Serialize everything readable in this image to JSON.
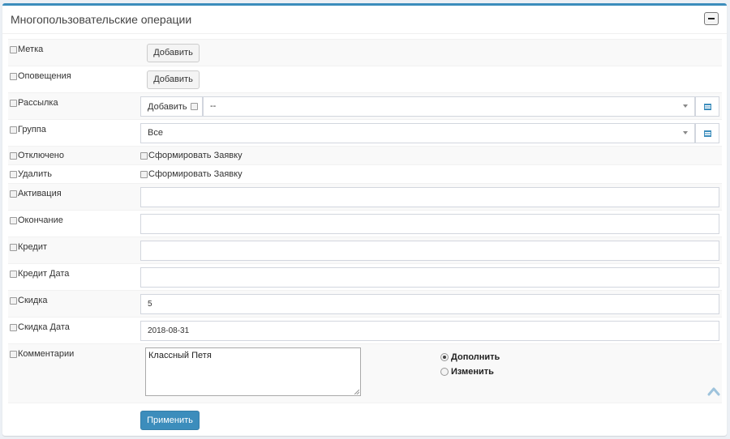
{
  "panel": {
    "title": "Многопользовательские операции",
    "collapse_icon": "minus-icon"
  },
  "rows": {
    "label": {
      "name": "Метка",
      "button": "Добавить"
    },
    "notifications": {
      "name": "Оповещения",
      "button": "Добавить"
    },
    "mailing": {
      "name": "Рассылка",
      "addon": "Добавить",
      "select_value": "--"
    },
    "group": {
      "name": "Группа",
      "select_value": "Все"
    },
    "disabled": {
      "name": "Отключено",
      "option": "Сформировать Заявку"
    },
    "delete": {
      "name": "Удалить",
      "option": "Сформировать Заявку"
    },
    "activation": {
      "name": "Активация",
      "value": ""
    },
    "ending": {
      "name": "Окончание",
      "value": ""
    },
    "credit": {
      "name": "Кредит",
      "value": ""
    },
    "credit_date": {
      "name": "Кредит Дата",
      "value": ""
    },
    "discount": {
      "name": "Скидка",
      "value": "5"
    },
    "discount_date": {
      "name": "Скидка Дата",
      "value": "2018-08-31"
    },
    "comments": {
      "name": "Комментарии",
      "value": "Классный Петя",
      "radio_append": "Дополнить",
      "radio_change": "Изменить",
      "selected": "Дополнить"
    }
  },
  "apply_button": "Применить",
  "colors": {
    "accent": "#3c8dbc",
    "background": "#ecf0f5"
  }
}
